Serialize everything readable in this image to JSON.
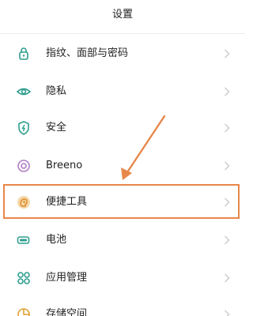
{
  "header": {
    "title": "设置"
  },
  "settings": {
    "items": [
      {
        "label": "指纹、面部与密码",
        "icon": "fingerprint-lock-icon"
      },
      {
        "label": "隐私",
        "icon": "privacy-eye-icon"
      },
      {
        "label": "安全",
        "icon": "security-shield-icon"
      },
      {
        "label": "Breeno",
        "icon": "breeno-icon"
      },
      {
        "label": "便捷工具",
        "icon": "convenience-tools-icon"
      },
      {
        "label": "电池",
        "icon": "battery-icon"
      },
      {
        "label": "应用管理",
        "icon": "app-management-icon"
      },
      {
        "label": "存储空间",
        "icon": "storage-icon"
      }
    ]
  },
  "colors": {
    "accent_icon": "#2f9e8f",
    "annotation": "#e8874a",
    "chevron": "#c8c8c8"
  }
}
